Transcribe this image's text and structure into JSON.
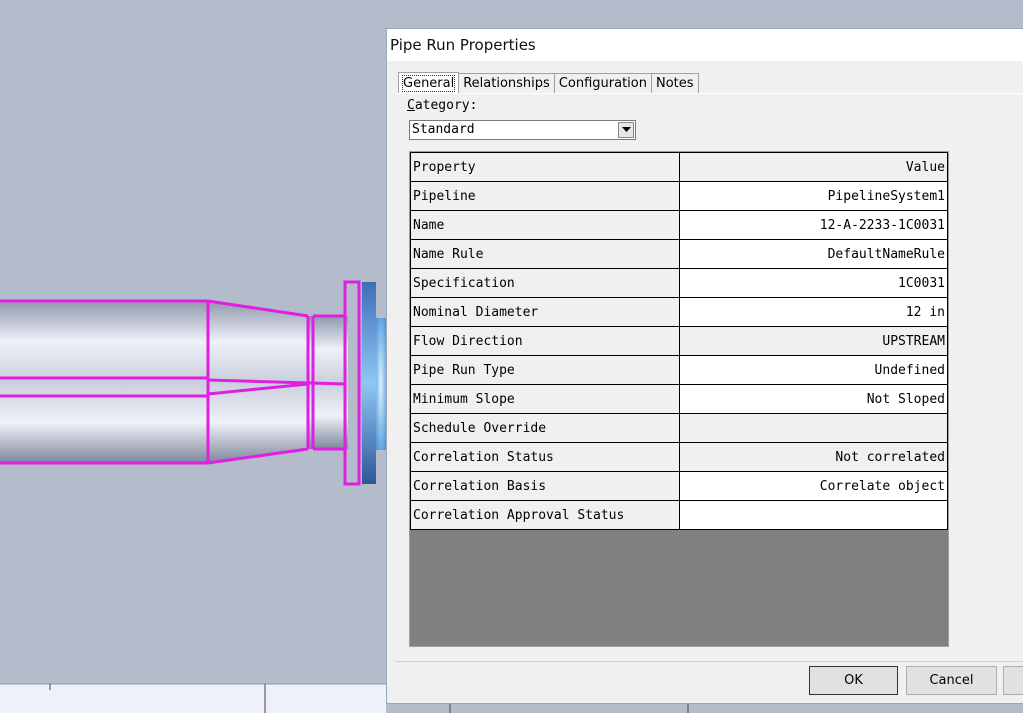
{
  "dialog": {
    "title": "Pipe Run Properties",
    "tabs": [
      {
        "label": "General",
        "active": true
      },
      {
        "label": "Relationships",
        "active": false
      },
      {
        "label": "Configuration",
        "active": false
      },
      {
        "label": "Notes",
        "active": false
      }
    ],
    "category_label_accel": "C",
    "category_label_rest": "ategory:",
    "category_value": "Standard",
    "grid": {
      "header": {
        "property": "Property",
        "value": "Value"
      },
      "rows": [
        {
          "property": "Pipeline",
          "value": "PipelineSystem1"
        },
        {
          "property": "Name",
          "value": "12-A-2233-1C0031"
        },
        {
          "property": "Name Rule",
          "value": "DefaultNameRule"
        },
        {
          "property": "Specification",
          "value": "1C0031"
        },
        {
          "property": "Nominal Diameter",
          "value": "12 in"
        },
        {
          "property": "Flow Direction",
          "value": "UPSTREAM"
        },
        {
          "property": "Pipe Run Type",
          "value": "Undefined"
        },
        {
          "property": "Minimum Slope",
          "value": "Not Sloped"
        },
        {
          "property": "Schedule Override",
          "value": ""
        },
        {
          "property": "Correlation Status",
          "value": "Not correlated"
        },
        {
          "property": "Correlation Basis",
          "value": "Correlate object"
        },
        {
          "property": "Correlation Approval Status",
          "value": ""
        }
      ]
    },
    "ok_label": "OK",
    "cancel_label": "Cancel"
  },
  "colors": {
    "viewport_bg": "#b4bccb",
    "highlight": "#e020e0",
    "grid_empty": "#808080"
  }
}
